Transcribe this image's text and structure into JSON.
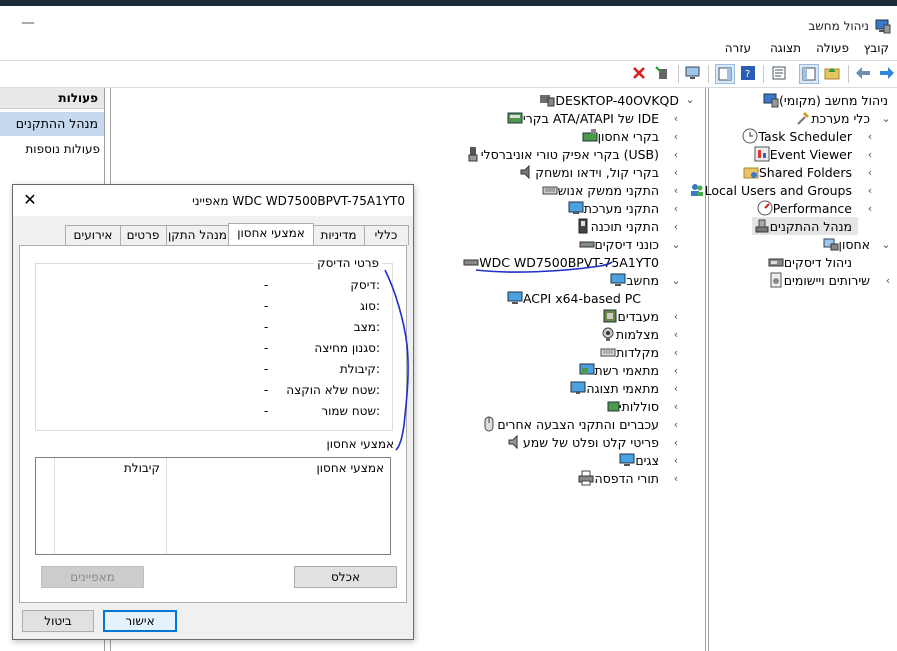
{
  "window": {
    "title": "ניהול מחשב"
  },
  "menu": [
    "קובץ",
    "פעולה",
    "תצוגה",
    "עזרה"
  ],
  "actions_pane": {
    "title": "פעולות",
    "selected": "מנהל ההתקנים",
    "more": "פעולות נוספות"
  },
  "tree": {
    "root": "ניהול מחשב (מקומי)",
    "system_tools": "כלי מערכת",
    "task_scheduler": "Task Scheduler",
    "event_viewer": "Event Viewer",
    "shared_folders": "Shared Folders",
    "local_users": "Local Users and Groups",
    "performance": "Performance",
    "device_manager": "מנהל ההתקנים",
    "storage": "אחסון",
    "disk_management": "ניהול דיסקים",
    "services": "שירותים ויישומים"
  },
  "devices": {
    "computer_name": "DESKTOP-40OVKQD",
    "items": [
      {
        "label": "בקרי ATA/ATAPI של IDE",
        "icon": "ide-controller-icon"
      },
      {
        "label": "בקרי אחסון",
        "icon": "storage-controller-icon"
      },
      {
        "label": "בקרי אפיק טורי אוניברסלי (USB)",
        "icon": "usb-icon"
      },
      {
        "label": "בקרי קול, וידאו ומשחק",
        "icon": "speaker-icon"
      },
      {
        "label": "התקני ממשק אנוש",
        "icon": "hid-icon"
      },
      {
        "label": "התקני מערכת",
        "icon": "system-device-icon"
      },
      {
        "label": "התקני תוכנה",
        "icon": "software-device-icon"
      },
      {
        "label": "כונני דיסקים",
        "icon": "disk-drive-icon"
      }
    ],
    "disk_child": "WDC WD7500BPVT-75A1YT0",
    "computer": "מחשב",
    "computer_child": "ACPI x64-based PC",
    "items2": [
      {
        "label": "מעבדים",
        "icon": "processor-icon"
      },
      {
        "label": "מצלמות",
        "icon": "camera-icon"
      },
      {
        "label": "מקלדות",
        "icon": "keyboard-icon"
      },
      {
        "label": "מתאמי רשת",
        "icon": "network-adapter-icon"
      },
      {
        "label": "מתאמי תצוגה",
        "icon": "display-adapter-icon"
      },
      {
        "label": "סוללות",
        "icon": "battery-icon"
      },
      {
        "label": "עכברים והתקני הצבעה אחרים",
        "icon": "mouse-icon"
      },
      {
        "label": "פריטי קלט ופלט של שמע",
        "icon": "audio-io-icon"
      },
      {
        "label": "צגים",
        "icon": "monitor-icon"
      },
      {
        "label": "תורי הדפסה",
        "icon": "printer-icon"
      }
    ]
  },
  "dialog": {
    "title": "מאפייני WDC WD7500BPVT-75A1YT0",
    "tabs": [
      "כללי",
      "מדיניות",
      "אמצעי אחסון",
      "מנהל התקן",
      "פרטים",
      "אירועים"
    ],
    "active_tab": "אמצעי אחסון",
    "group1_title": "פרטי הדיסק",
    "properties": [
      {
        "label": "דיסק:",
        "value": "-"
      },
      {
        "label": "סוג:",
        "value": "-"
      },
      {
        "label": "מצב:",
        "value": "-"
      },
      {
        "label": "סגנון מחיצה:",
        "value": "-"
      },
      {
        "label": "קיבולת:",
        "value": "-"
      },
      {
        "label": "שטח שלא הוקצה:",
        "value": "-"
      },
      {
        "label": "שטח שמור:",
        "value": "-"
      }
    ],
    "group2_title": "אמצעי אחסון",
    "table_headers": [
      "אמצעי אחסון",
      "קיבולת"
    ],
    "populate_btn": "אכלס",
    "properties_btn": "מאפיינים",
    "ok_btn": "אישור",
    "cancel_btn": "ביטול"
  },
  "colors": {
    "selection": "#c5d9ef",
    "annotation": "#1f2fc8",
    "accent": "#0078d7"
  }
}
